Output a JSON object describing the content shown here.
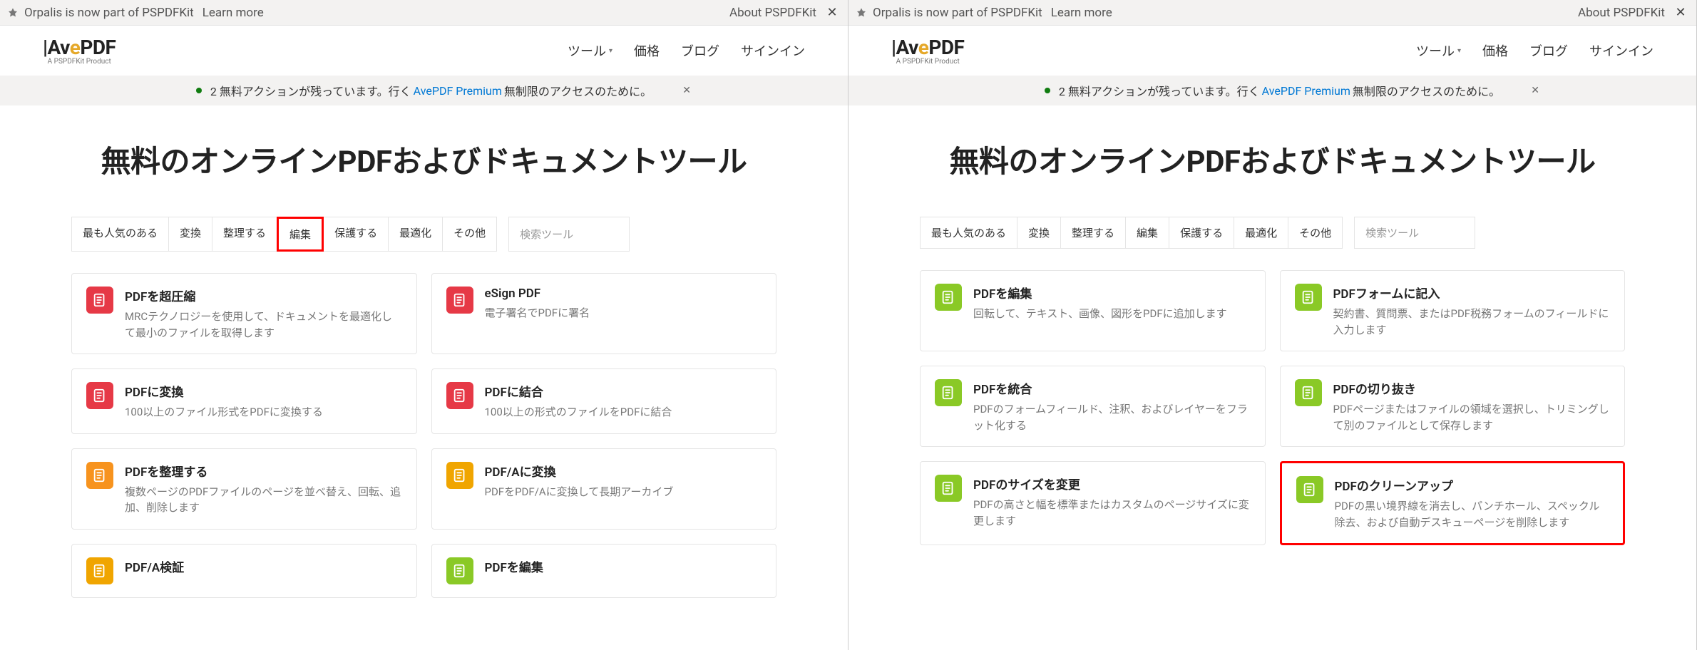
{
  "topbar": {
    "announce": "Orpalis is now part of PSPDFKit",
    "learn_more": "Learn more",
    "about": "About PSPDFKit"
  },
  "logo": {
    "text_prefix": "|Av",
    "text_accent": "e",
    "text_suffix": "PDF",
    "sub": "A PSPDFKit Product"
  },
  "nav": {
    "tools": "ツール",
    "price": "価格",
    "blog": "ブログ",
    "signin": "サインイン"
  },
  "banner": {
    "text_prefix": "2 無料アクションが残っています。行く ",
    "premium_text": "AvePDF Premium",
    "text_suffix": " 無制限のアクセスのために。"
  },
  "page_title": "無料のオンラインPDFおよびドキュメントツール",
  "filters": {
    "items": [
      "最も人気のある",
      "変換",
      "整理する",
      "編集",
      "保護する",
      "最適化",
      "その他"
    ],
    "search_placeholder": "検索ツール"
  },
  "left_tools": [
    {
      "icon": "red",
      "title": "PDFを超圧縮",
      "desc": "MRCテクノロジーを使用して、ドキュメントを最適化して最小のファイルを取得します"
    },
    {
      "icon": "red",
      "title": "eSign PDF",
      "desc": "電子署名でPDFに署名"
    },
    {
      "icon": "red",
      "title": "PDFに変換",
      "desc": "100以上のファイル形式をPDFに変換する"
    },
    {
      "icon": "red",
      "title": "PDFに結合",
      "desc": "100以上の形式のファイルをPDFに結合"
    },
    {
      "icon": "orange",
      "title": "PDFを整理する",
      "desc": "複数ページのPDFファイルのページを並べ替え、回転、追加、削除します"
    },
    {
      "icon": "orange2",
      "title": "PDF/Aに変換",
      "desc": "PDFをPDF/Aに変換して長期アーカイブ"
    },
    {
      "icon": "orange2",
      "title": "PDF/A検証",
      "desc": ""
    },
    {
      "icon": "green",
      "title": "PDFを編集",
      "desc": ""
    }
  ],
  "right_tools": [
    {
      "icon": "green",
      "title": "PDFを編集",
      "desc": "回転して、テキスト、画像、図形をPDFに追加します"
    },
    {
      "icon": "green",
      "title": "PDFフォームに記入",
      "desc": "契約書、質問票、またはPDF税務フォームのフィールドに入力します"
    },
    {
      "icon": "green",
      "title": "PDFを統合",
      "desc": "PDFのフォームフィールド、注釈、およびレイヤーをフラット化する"
    },
    {
      "icon": "green",
      "title": "PDFの切り抜き",
      "desc": "PDFページまたはファイルの領域を選択し、トリミングして別のファイルとして保存します"
    },
    {
      "icon": "green",
      "title": "PDFのサイズを変更",
      "desc": "PDFの高さと幅を標準またはカスタムのページサイズに変更します"
    },
    {
      "icon": "green",
      "title": "PDFのクリーンアップ",
      "desc": "PDFの黒い境界線を消去し、パンチホール、スペックル除去、および自動デスキューページを削除します"
    }
  ]
}
